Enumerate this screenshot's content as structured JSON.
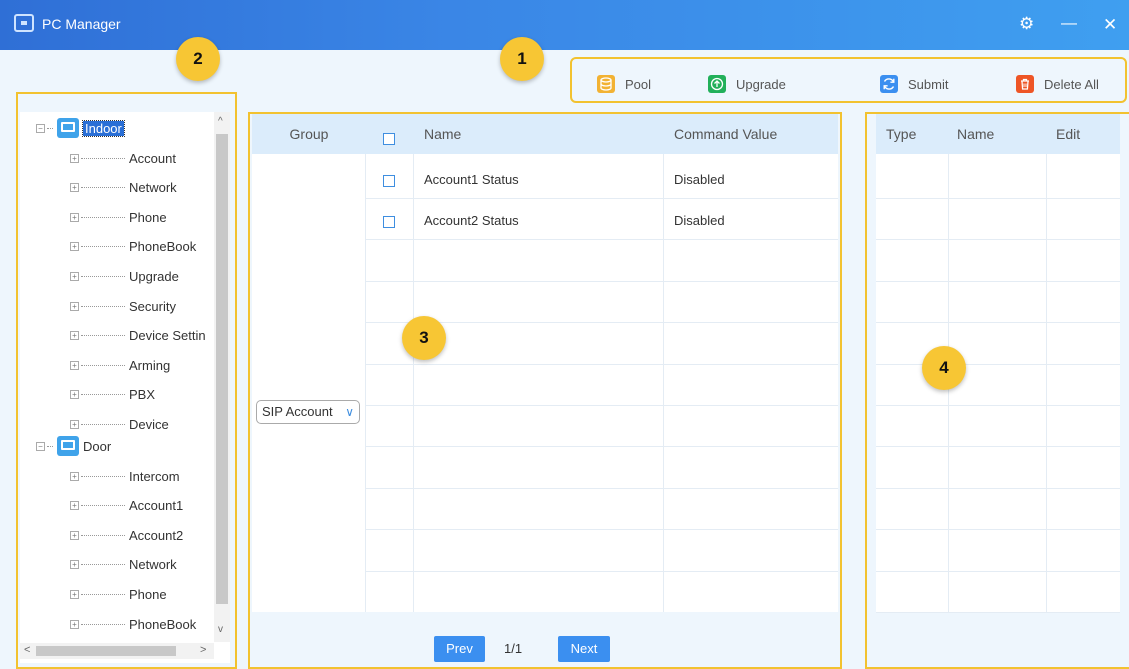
{
  "app": {
    "title": "PC Manager"
  },
  "window_controls": {
    "settings_glyph": "⚙",
    "minimize_glyph": "—",
    "close_glyph": "✕"
  },
  "badges": [
    "1",
    "2",
    "3",
    "4"
  ],
  "toolbar": {
    "pool": "Pool",
    "upgrade": "Upgrade",
    "submit": "Submit",
    "delete_all": "Delete All"
  },
  "tree": {
    "indoor": {
      "label": "Indoor",
      "children": [
        "Account",
        "Network",
        "Phone",
        "PhoneBook",
        "Upgrade",
        "Security",
        "Device Settin",
        "Arming",
        "PBX",
        "Device"
      ]
    },
    "door": {
      "label": "Door",
      "children": [
        "Intercom",
        "Account1",
        "Account2",
        "Network",
        "Phone",
        "PhoneBook"
      ]
    }
  },
  "command_table": {
    "headers": {
      "group": "Group",
      "name": "Name",
      "value": "Command Value"
    },
    "rows": [
      {
        "name": "Account1 Status",
        "value": "Disabled"
      },
      {
        "name": "Account2 Status",
        "value": "Disabled"
      }
    ],
    "group_select": "SIP Account"
  },
  "pagination": {
    "prev": "Prev",
    "page": "1/1",
    "next": "Next"
  },
  "side_table": {
    "headers": {
      "type": "Type",
      "name": "Name",
      "edit": "Edit"
    }
  },
  "colors": {
    "highlight": "#f2c230",
    "badge": "#f7c634",
    "accent": "#3b8ff0",
    "titlebar": "#3a86e6"
  }
}
